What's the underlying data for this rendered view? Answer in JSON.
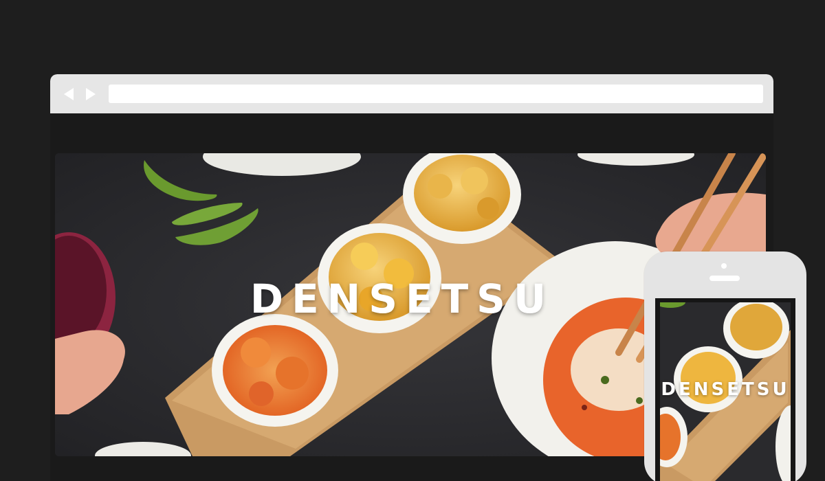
{
  "browser": {
    "back_icon": "back-triangle-icon",
    "forward_icon": "forward-triangle-icon",
    "address_value": ""
  },
  "hero": {
    "title": "DENSETSU"
  },
  "phone": {
    "title": "DENSETSU"
  },
  "colors": {
    "background": "#1e1e1e",
    "chrome": "#e6e6e6",
    "table": "#2b2b2e",
    "wood_board": "#c99a63",
    "sauce_orange": "#e8762a",
    "edamame": "#6a9a2e"
  }
}
